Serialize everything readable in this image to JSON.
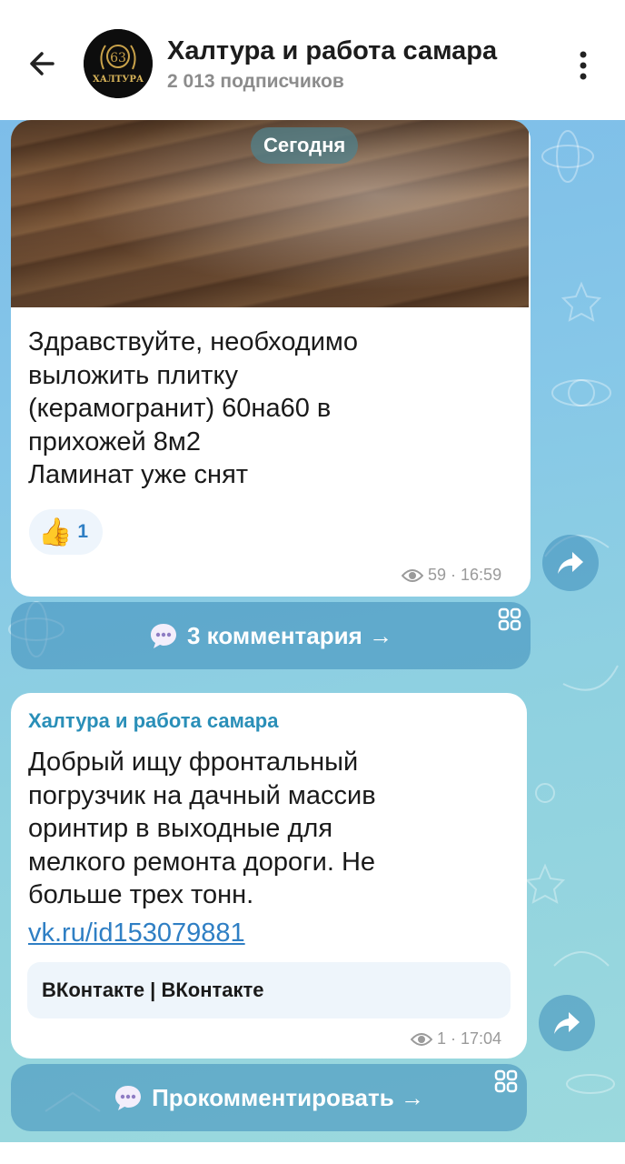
{
  "header": {
    "title": "Халтура и работа самара",
    "subscribers": "2 013 подписчиков",
    "avatar_text_top": "63",
    "avatar_text_bottom": "ХАЛТУРА"
  },
  "date_pill": "Сегодня",
  "messages": [
    {
      "text": "Здравствуйте, необходимо\nвыложить плитку\n(керамогранит) 60на60 в\nприхожей 8м2\nЛаминат уже снят",
      "reaction": {
        "emoji": "👍",
        "count": "1"
      },
      "views": "59",
      "time": "16:59",
      "comments_label": "3 комментария →"
    },
    {
      "sender": "Халтура и работа самара",
      "text": "Добрый  ищу фронтальный\nпогрузчик на дачный массив\nоринтир в выходные для\nмелкого ремонта дороги. Не\nбольше трех тонн.",
      "link": "vk.ru/id153079881",
      "preview_title": "ВКонтакте | ВКонтакте",
      "views": "1",
      "time": "17:04",
      "comments_label": "Прокомментировать →"
    }
  ],
  "icons": {
    "back": "arrow-left-icon",
    "menu": "more-vertical-icon",
    "share": "share-arrow-icon",
    "views": "eye-icon",
    "comments": "speech-bubble-icon"
  },
  "colors": {
    "accent": "#2f7fc4",
    "sender": "#2a8fb8",
    "chat_bg": "#86c7e8"
  }
}
